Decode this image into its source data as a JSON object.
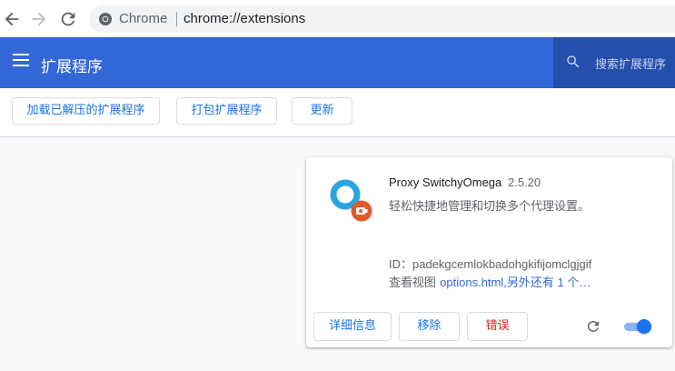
{
  "browser": {
    "site_label": "Chrome",
    "url": "chrome://extensions"
  },
  "header": {
    "title": "扩展程序",
    "search_placeholder": "搜索扩展程序"
  },
  "toolbar": {
    "load_unpacked": "加载已解压的扩展程序",
    "pack": "打包扩展程序",
    "update": "更新"
  },
  "extension": {
    "name": "Proxy SwitchyOmega",
    "version": "2.5.20",
    "description": "轻松快捷地管理和切换多个代理设置。",
    "id_text": "ID：padekgcemlokbadohgkifijomclgjgif",
    "views_label": "查看视图",
    "views_link": "options.html,另外还有 1 个…",
    "details_button": "详细信息",
    "remove_button": "移除",
    "errors_button": "错误",
    "enabled": true
  },
  "colors": {
    "header": "#3367d6",
    "search_box": "#254fac",
    "link": "#3367d6",
    "error": "#c5221f",
    "toggle_on": "#1a73e8"
  }
}
